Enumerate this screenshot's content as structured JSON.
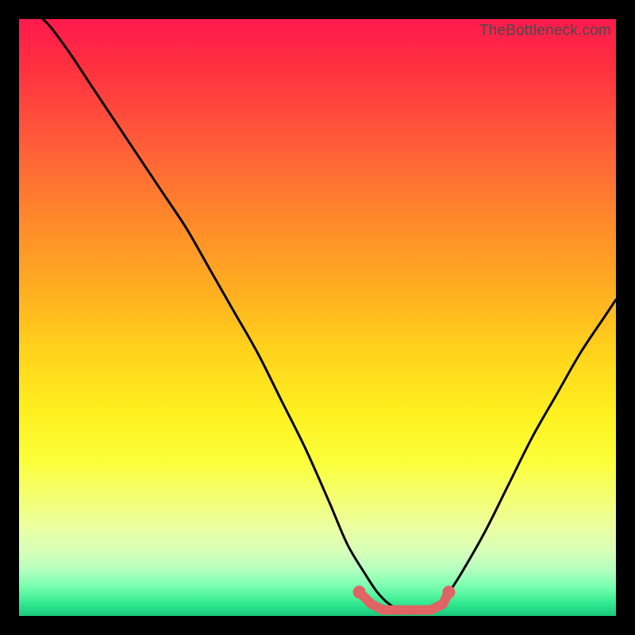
{
  "watermark": "TheBottleneck.com",
  "chart_data": {
    "type": "line",
    "title": "",
    "xlabel": "",
    "ylabel": "",
    "xlim": [
      0,
      100
    ],
    "ylim": [
      0,
      100
    ],
    "series": [
      {
        "name": "bottleneck-curve",
        "x": [
          0,
          4,
          8,
          12,
          16,
          20,
          24,
          28,
          32,
          36,
          40,
          44,
          48,
          52,
          55,
          58,
          60,
          62,
          64,
          66,
          68,
          70,
          72,
          74,
          78,
          82,
          86,
          90,
          94,
          98,
          100
        ],
        "values": [
          102,
          100,
          95,
          89,
          83,
          77,
          71,
          65,
          58,
          51,
          44,
          36,
          28,
          19,
          12,
          7,
          4,
          2,
          1,
          1,
          1,
          2,
          4,
          7,
          14,
          22,
          30,
          37,
          44,
          50,
          53
        ]
      }
    ],
    "markers": {
      "name": "flat-markers",
      "x": [
        57,
        59,
        61,
        63,
        65,
        67,
        69,
        71,
        72
      ],
      "values": [
        4,
        2,
        1,
        1,
        1,
        1,
        1,
        2,
        4
      ],
      "color": "#e06464",
      "radius": 6
    }
  },
  "colors": {
    "curve_stroke": "#000000",
    "marker_fill": "#e06464",
    "background_black": "#000000"
  }
}
